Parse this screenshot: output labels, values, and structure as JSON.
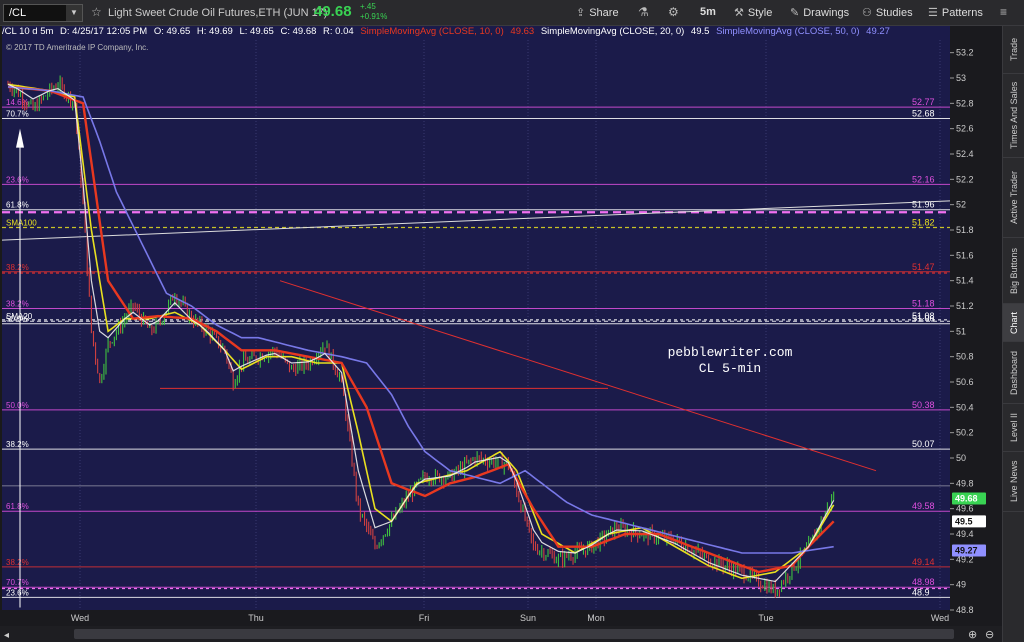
{
  "toolbar": {
    "symbol": "/CL",
    "description": "Light Sweet Crude Oil Futures,ETH (JUN 17)",
    "last_price": "49.68",
    "net_change": "+.45",
    "pct_change": "+0.91%",
    "buttons": [
      "Share",
      "5m",
      "Style",
      "Drawings",
      "Studies",
      "Patterns"
    ]
  },
  "info_bar": {
    "symbol_period": "/CL 10 d 5m",
    "datetime": "D: 4/25/17 12:05 PM",
    "open": "O: 49.65",
    "high": "H: 49.69",
    "low": "L: 49.65",
    "close": "C: 49.68",
    "range": "R: 0.04",
    "sma10_label": "SimpleMovingAvg (CLOSE, 10, 0)",
    "sma10_value": "49.63",
    "sma20_label": "SimpleMovingAvg (CLOSE, 20, 0)",
    "sma20_value": "49.5",
    "sma50_label": "SimpleMovingAvg (CLOSE, 50, 0)",
    "sma50_value": "49.27"
  },
  "copyright": "© 2017 TD Ameritrade IP Company, Inc.",
  "watermark": [
    "pebblewriter.com",
    "CL 5-min"
  ],
  "right_tabs": [
    "Trade",
    "Times And Sales",
    "Active Trader",
    "Big Buttons",
    "Chart",
    "Dashboard",
    "Level II",
    "Live News"
  ],
  "colors": {
    "background": "#1b1b4a",
    "sma10": "#e8e020",
    "sma20": "#e83820",
    "sma50": "#7878e8",
    "fib_pink": "#e050e0",
    "fib_red": "#e03030",
    "up_candle": "#40c040",
    "down_candle": "#d04040"
  },
  "chart_data": {
    "type": "line",
    "title": "/CL 10 d 5m",
    "ylim": [
      48.8,
      53.3
    ],
    "y_ticks": [
      48.8,
      49,
      49.2,
      49.4,
      49.6,
      49.8,
      50,
      50.2,
      50.4,
      50.6,
      50.8,
      51,
      51.2,
      51.4,
      51.6,
      51.8,
      52,
      52.2,
      52.4,
      52.6,
      52.8,
      53,
      53.2
    ],
    "x_ticks": [
      "Wed",
      "Thu",
      "Fri",
      "Sun",
      "Mon",
      "Tue",
      "Wed"
    ],
    "price_labels": [
      {
        "value": "49.68",
        "color": "#39d353"
      },
      {
        "value": "49.5",
        "color": "#ffffff"
      },
      {
        "value": "49.27",
        "color": "#9090ff"
      }
    ],
    "series": [
      {
        "name": "Price",
        "x": [
          0,
          1,
          3,
          5,
          6,
          8,
          9,
          10,
          11,
          12,
          13,
          14,
          15,
          16,
          17,
          18,
          20,
          22,
          24,
          26,
          27,
          28,
          30,
          32,
          34,
          36,
          38,
          40,
          42,
          44,
          46,
          48,
          50,
          53,
          56,
          60,
          63,
          66,
          70,
          73,
          76,
          80,
          84,
          88,
          92,
          96,
          99
        ],
        "values": [
          52.95,
          52.9,
          52.75,
          52.9,
          52.95,
          52.8,
          52.0,
          51.0,
          50.6,
          50.9,
          51.0,
          51.1,
          51.2,
          51.1,
          51.0,
          51.05,
          51.3,
          51.1,
          51.0,
          50.85,
          50.6,
          50.75,
          50.8,
          50.85,
          50.7,
          50.75,
          50.9,
          50.6,
          49.6,
          49.3,
          49.5,
          49.7,
          49.85,
          49.85,
          50.0,
          49.95,
          49.3,
          49.2,
          49.3,
          49.45,
          49.4,
          49.35,
          49.2,
          49.1,
          48.95,
          49.3,
          49.7
        ]
      },
      {
        "name": "SMA10",
        "x": [
          0,
          5,
          8,
          10,
          12,
          14,
          17,
          20,
          23,
          26,
          28,
          31,
          34,
          37,
          40,
          42,
          44,
          46,
          49,
          52,
          55,
          59,
          61,
          64,
          68,
          72,
          76,
          80,
          84,
          88,
          92,
          96,
          99
        ],
        "values": [
          52.95,
          52.9,
          52.85,
          51.8,
          51.0,
          51.1,
          51.1,
          51.15,
          51.05,
          50.85,
          50.7,
          50.8,
          50.8,
          50.75,
          50.75,
          50.2,
          49.6,
          49.5,
          49.8,
          49.85,
          49.9,
          50.05,
          49.9,
          49.4,
          49.25,
          49.4,
          49.45,
          49.3,
          49.15,
          49.05,
          49.1,
          49.3,
          49.63
        ]
      },
      {
        "name": "SMA20",
        "x": [
          0,
          5,
          9,
          12,
          15,
          18,
          22,
          25,
          28,
          32,
          36,
          40,
          43,
          46,
          50,
          53,
          56,
          60,
          63,
          66,
          70,
          74,
          78,
          82,
          86,
          90,
          94,
          96,
          99
        ],
        "values": [
          52.93,
          52.9,
          52.8,
          51.4,
          51.1,
          51.12,
          51.1,
          51.0,
          50.85,
          50.85,
          50.8,
          50.75,
          50.4,
          49.8,
          49.7,
          49.8,
          49.85,
          49.95,
          49.6,
          49.3,
          49.3,
          49.4,
          49.4,
          49.3,
          49.2,
          49.1,
          49.15,
          49.3,
          49.5
        ]
      },
      {
        "name": "SMA50",
        "x": [
          0,
          5,
          9,
          11,
          13,
          16,
          19,
          22,
          25,
          28,
          30,
          33,
          36,
          40,
          43,
          46,
          48,
          50,
          53,
          56,
          59,
          62,
          64,
          67,
          70,
          73,
          76,
          79,
          82,
          85,
          88,
          91,
          94,
          96,
          99
        ],
        "values": [
          52.93,
          52.9,
          52.85,
          52.5,
          52.1,
          51.7,
          51.3,
          51.2,
          51.05,
          50.95,
          50.95,
          50.9,
          50.85,
          50.8,
          50.75,
          50.5,
          50.25,
          50.05,
          49.9,
          49.85,
          49.8,
          49.9,
          49.8,
          49.65,
          49.55,
          49.5,
          49.45,
          49.4,
          49.35,
          49.3,
          49.25,
          49.25,
          49.25,
          49.27,
          49.3
        ]
      }
    ],
    "fib_levels": [
      {
        "label": "14.6%",
        "value": 52.77,
        "color": "#e050e0",
        "text": "52.77"
      },
      {
        "label": "70.7%",
        "value": 52.68,
        "color": "#ffffff",
        "text": "52.68"
      },
      {
        "label": "23.6%",
        "value": 52.16,
        "color": "#e050e0",
        "text": "52.16"
      },
      {
        "label": "61.8%",
        "value": 51.96,
        "color": "#ffffff",
        "text": "51.96"
      },
      {
        "label": "SMA100",
        "value": 51.82,
        "color": "#e8e020",
        "text": "51.82"
      },
      {
        "label": "38.2%",
        "value": 51.47,
        "color": "#e03030",
        "text": "51.47"
      },
      {
        "label": "38.2%",
        "value": 51.18,
        "color": "#e050e0",
        "text": "51.18"
      },
      {
        "label": "SMA20",
        "value": 51.08,
        "color": "#ffffff",
        "text": "51.08"
      },
      {
        "label": "50.0%",
        "value": 51.06,
        "color": "#ffffff",
        "text": "51.06"
      },
      {
        "label": "50.0%",
        "value": 50.38,
        "color": "#e050e0",
        "text": "50.38"
      },
      {
        "label": "38.2%",
        "value": 50.07,
        "color": "#ffffff",
        "text": "50.07"
      },
      {
        "label": "61.8%",
        "value": 49.58,
        "color": "#e050e0",
        "text": "49.58"
      },
      {
        "label": "38.2%",
        "value": 49.14,
        "color": "#e03030",
        "text": "49.14"
      },
      {
        "label": "70.7%",
        "value": 48.98,
        "color": "#e050e0",
        "text": "48.98"
      },
      {
        "label": "23.6%",
        "value": 48.9,
        "color": "#ffffff",
        "text": "48.9"
      }
    ]
  }
}
